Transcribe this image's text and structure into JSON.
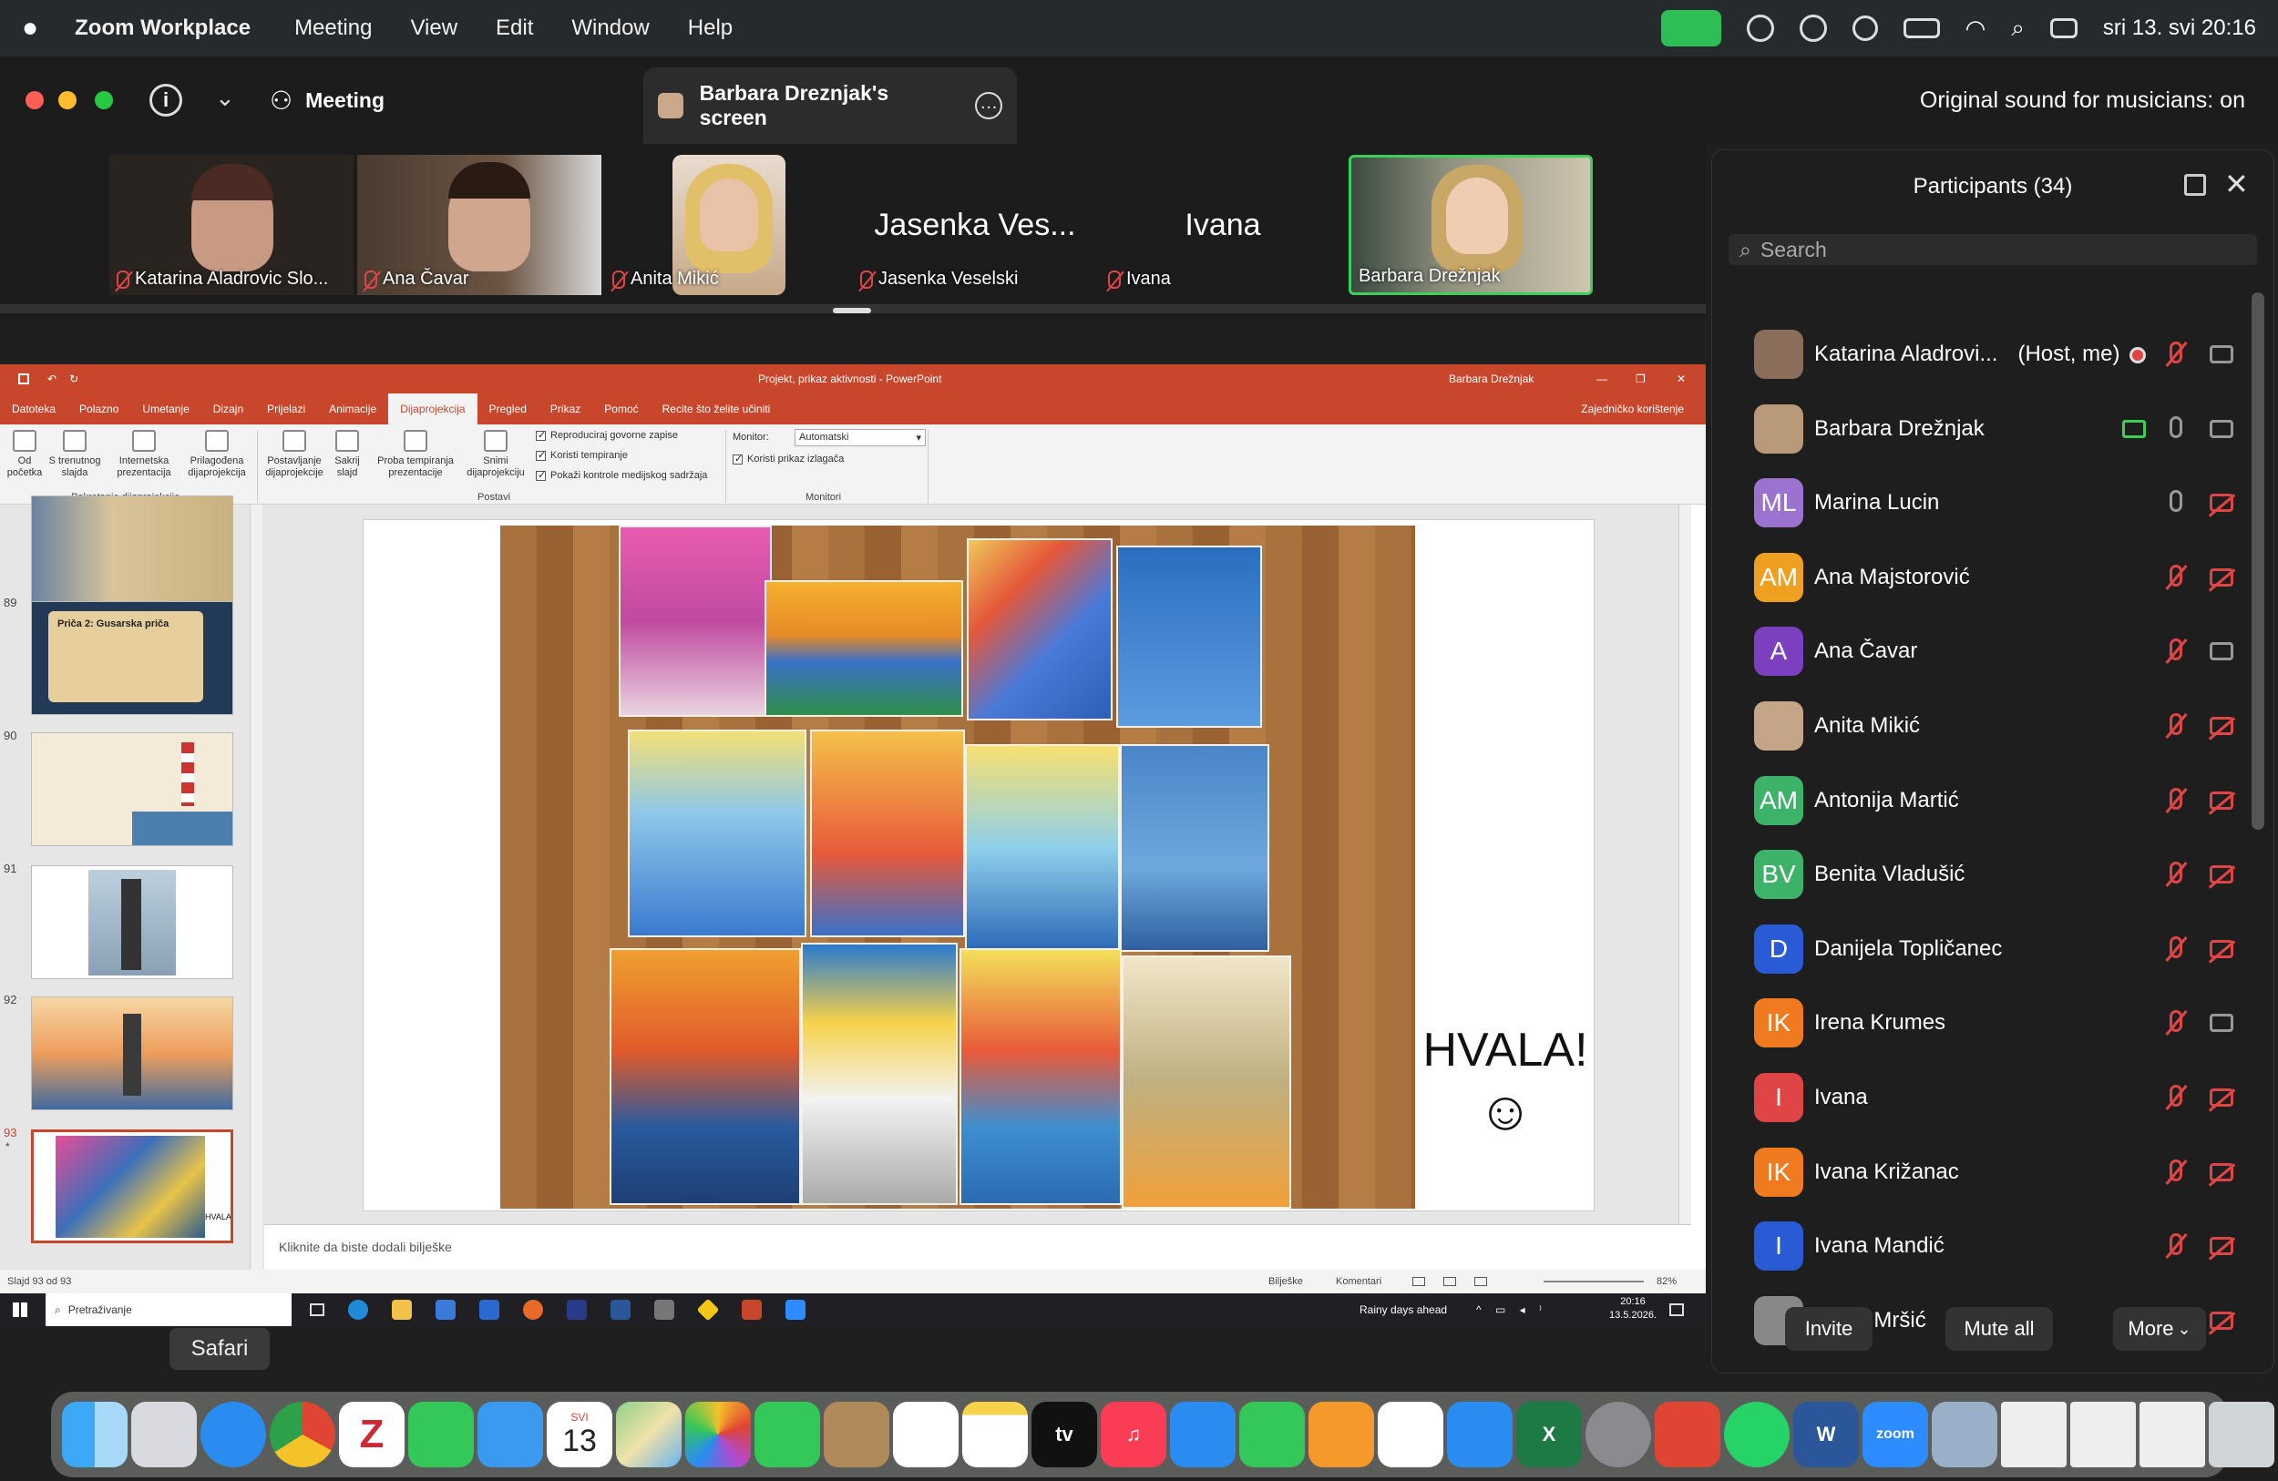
{
  "menubar": {
    "app": "Zoom Workplace",
    "items": [
      "Meeting",
      "View",
      "Edit",
      "Window",
      "Help"
    ],
    "datetime": "sri 13. svi  20:16"
  },
  "zoom": {
    "meeting_label": "Meeting",
    "share_title": "Barbara Dreznjak's screen",
    "original_sound": "Original sound for musicians: on"
  },
  "videos": [
    {
      "name": "Katarina Aladrovic Slo...",
      "muted": true
    },
    {
      "name": "Ana Čavar",
      "muted": true
    },
    {
      "name": "Anita Mikić",
      "muted": true
    },
    {
      "name": "Jasenka Veselski",
      "big": "Jasenka Ves...",
      "muted": true
    },
    {
      "name": "Ivana",
      "big": "Ivana",
      "muted": true
    },
    {
      "name": "Barbara Drežnjak",
      "muted": false
    }
  ],
  "ppt": {
    "title": "Projekt, prikaz aktivnosti  -  PowerPoint",
    "user": "Barbara Drežnjak",
    "tabs": [
      "Datoteka",
      "Polazno",
      "Umetanje",
      "Dizajn",
      "Prijelazi",
      "Animacije",
      "Dijaprojekcija",
      "Pregled",
      "Prikaz",
      "Pomoć",
      "Recite što želite učiniti"
    ],
    "share": "Zajedničko korištenje",
    "ribbon": {
      "btn_from_start": "Od\npočetka",
      "btn_current": "S trenutnog\nslajda",
      "btn_online": "Internetska\nprezentacija",
      "btn_custom": "Prilagođena\ndijaprojekcija",
      "group1": "Pokretanje dijaprojekcije",
      "btn_setup": "Postavljanje\ndijaprojekcije",
      "btn_hide": "Sakrij\nslajd",
      "btn_rehearse": "Proba tempiranja\nprezentacije",
      "btn_record": "Snimi\ndijaprojekciju",
      "group2": "Postavi",
      "chk1": "Reproduciraj govorne zapise",
      "chk2": "Koristi tempiranje",
      "chk3": "Pokaži kontrole medijskog sadržaja",
      "monitor_label": "Monitor:",
      "monitor_value": "Automatski",
      "chk4": "Koristi prikaz izlagača",
      "group3": "Monitori"
    },
    "slides": [
      {
        "num": "89",
        "title": "Priča 2: Gusarska priča"
      },
      {
        "num": "90"
      },
      {
        "num": "91"
      },
      {
        "num": "92"
      },
      {
        "num": "93"
      }
    ],
    "slide_text": {
      "thanks": "HVALA!",
      "smiley": "☺"
    },
    "notes_placeholder": "Kliknite da biste dodali bilješke",
    "status_left": "Slajd 93 od 93",
    "status_notes": "Bilješke",
    "status_comments": "Komentari",
    "zoom": "82%",
    "taskbar": {
      "search": "Pretraživanje",
      "weather": "Rainy days ahead",
      "time": "20:16",
      "date": "13.5.2026."
    }
  },
  "participants": {
    "title": "Participants (34)",
    "search_placeholder": "Search",
    "list": [
      {
        "initials": "",
        "name": "Katarina Aladrovi...",
        "suffix": "(Host, me)",
        "color": "#8a6e5a",
        "photo": true,
        "mic": "off",
        "cam": "ok",
        "rec": true
      },
      {
        "initials": "",
        "name": "Barbara Drežnjak",
        "color": "#b89a7a",
        "photo": true,
        "mic": "ok",
        "cam": "ok",
        "sharing": true
      },
      {
        "initials": "ML",
        "name": "Marina Lucin",
        "color": "#9b72cf",
        "mic": "ok",
        "cam": "off"
      },
      {
        "initials": "AM",
        "name": "Ana Majstorović",
        "color": "#f0a020",
        "mic": "off",
        "cam": "off"
      },
      {
        "initials": "A",
        "name": "Ana Čavar",
        "color": "#7b3fc0",
        "mic": "off",
        "cam": "ok"
      },
      {
        "initials": "",
        "name": "Anita Mikić",
        "color": "#c4a588",
        "photo": true,
        "mic": "off",
        "cam": "off"
      },
      {
        "initials": "AM",
        "name": "Antonija Martić",
        "color": "#3db36a",
        "mic": "off",
        "cam": "off"
      },
      {
        "initials": "BV",
        "name": "Benita Vladušić",
        "color": "#3db36a",
        "mic": "off",
        "cam": "off"
      },
      {
        "initials": "D",
        "name": "Danijela Topličanec",
        "color": "#2a5bd7",
        "mic": "off",
        "cam": "off"
      },
      {
        "initials": "IK",
        "name": "Irena Krumes",
        "color": "#f07a20",
        "mic": "off",
        "cam": "ok"
      },
      {
        "initials": "I",
        "name": "Ivana",
        "color": "#e04545",
        "mic": "off",
        "cam": "off"
      },
      {
        "initials": "IK",
        "name": "Ivana Križanac",
        "color": "#f07a20",
        "mic": "off",
        "cam": "off"
      },
      {
        "initials": "I",
        "name": "Ivana Mandić",
        "color": "#2a5bd7",
        "mic": "off",
        "cam": "off"
      },
      {
        "initials": "",
        "name": "Ivana Mršić",
        "color": "#888",
        "photo": true,
        "mic": "off",
        "cam": "off"
      }
    ],
    "btn_invite": "Invite",
    "btn_mute_all": "Mute all",
    "btn_more": "More"
  },
  "dock": {
    "tooltip": "Safari",
    "calendar_day": "13",
    "calendar_month": "SVI",
    "tv_label": "tv"
  }
}
